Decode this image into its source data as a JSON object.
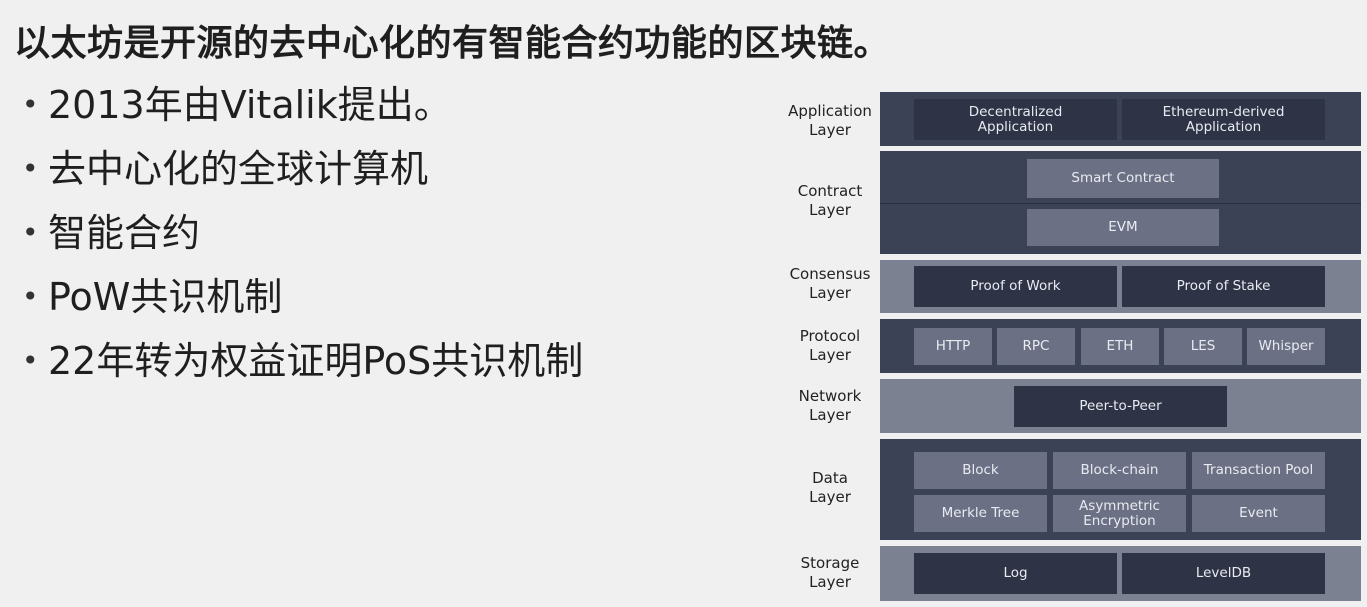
{
  "title": "以太坊是开源的去中心化的有智能合约功能的区块链。",
  "bullets": [
    "2013年由Vitalik提出。",
    "去中心化的全球计算机",
    "智能合约",
    "PoW共识机制",
    "22年转为权益证明PoS共识机制"
  ],
  "diagram": {
    "layers": [
      {
        "label": "Application\nLayer",
        "boxes": [
          "Decentralized\nApplication",
          "Ethereum-derived\nApplication"
        ]
      },
      {
        "label": "Contract\nLayer",
        "boxes": [
          "Smart Contract",
          "EVM"
        ]
      },
      {
        "label": "Consensus\nLayer",
        "boxes": [
          "Proof of Work",
          "Proof of Stake"
        ]
      },
      {
        "label": "Protocol\nLayer",
        "boxes": [
          "HTTP",
          "RPC",
          "ETH",
          "LES",
          "Whisper"
        ]
      },
      {
        "label": "Network\nLayer",
        "boxes": [
          "Peer-to-Peer"
        ]
      },
      {
        "label": "Data\nLayer",
        "boxes": [
          "Block",
          "Block-chain",
          "Transaction Pool",
          "Merkle Tree",
          "Asymmetric\nEncryption",
          "Event"
        ]
      },
      {
        "label": "Storage\nLayer",
        "boxes": [
          "Log",
          "LevelDB"
        ]
      }
    ],
    "colors": {
      "band_dark": "#3c4256",
      "band_light": "#7c8192",
      "box_dark": "#2e3346",
      "box_mid": "#6b7084"
    }
  }
}
